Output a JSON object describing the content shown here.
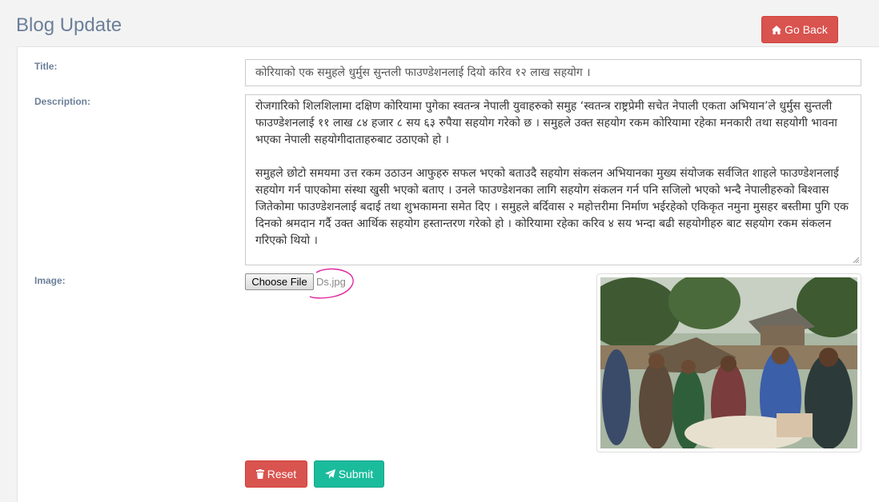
{
  "page": {
    "title": "Blog Update"
  },
  "header": {
    "go_back_label": "Go Back",
    "go_back_icon": "home-icon"
  },
  "form": {
    "title_label": "Title:",
    "title_value": "कोरियाको एक समुहले धुर्मुस सुन्तली फाउण्डेशनलाई दियो करिव १२ लाख सहयोग ।",
    "description_label": "Description:",
    "description_paragraphs": [
      "रोजगारिको शिलशिलामा दक्षिण कोरियामा पुगेका स्वतन्त्र नेपाली युवाहरुको समुह ‘स्वतन्त्र राष्ट्रप्रेमी सचेत नेपाली एकता अभियान’ले धुर्मुस सुन्तली फाउण्डेशनलाई ११ लाख ८४ हजार ८ सय ६३ रुपैया सहयोग गरेको छ । समुहले उक्त सहयोग रकम कोरियामा रहेका मनकारी तथा सहयोगी भावना भएका नेपाली सहयोगीदाताहरुबाट उठाएको हो ।",
      "समुहले छोटो समयमा उत्त रकम उठाउन आफुहरु सफल भएको बताउदै सहयोग संकलन अभियानका मुख्य संयोजक सर्वजित शाहले फाउण्डेशनलाई सहयोग गर्न पाएकोमा संस्था खुसी भएको बताए । उनले फाउण्डेशनका लागि सहयोग संकलन गर्न पनि सजिलो भएको भन्दै नेपालीहरुको बिश्वास जितेकोमा फाउण्डेशनलाई बदाई तथा शुभकामना समेत दिए । समुहले बर्दिवास २ महोत्तरीमा निर्माण भईरहेको एकिकृत नमुना मुसहर बस्तीमा पुगि एक दिनको श्रमदान गर्दै उक्त आर्थिक सहयोग हस्तान्तरण गरेको हो । कोरियामा रहेका करिव ४ सय भन्दा बढी सहयोगीहरु बाट सहयोग रकम संकलन गरिएको थियो ।"
    ],
    "image_label": "Image:",
    "choose_file_label": "Choose File",
    "file_name": "Ds.jpg"
  },
  "actions": {
    "reset_label": "Reset",
    "reset_icon": "trash-icon",
    "submit_label": "Submit",
    "submit_icon": "paper-plane-icon"
  },
  "colors": {
    "danger": "#d9534f",
    "success": "#1abc9c",
    "label": "#6b7f99",
    "annotation": "#e0209e"
  }
}
